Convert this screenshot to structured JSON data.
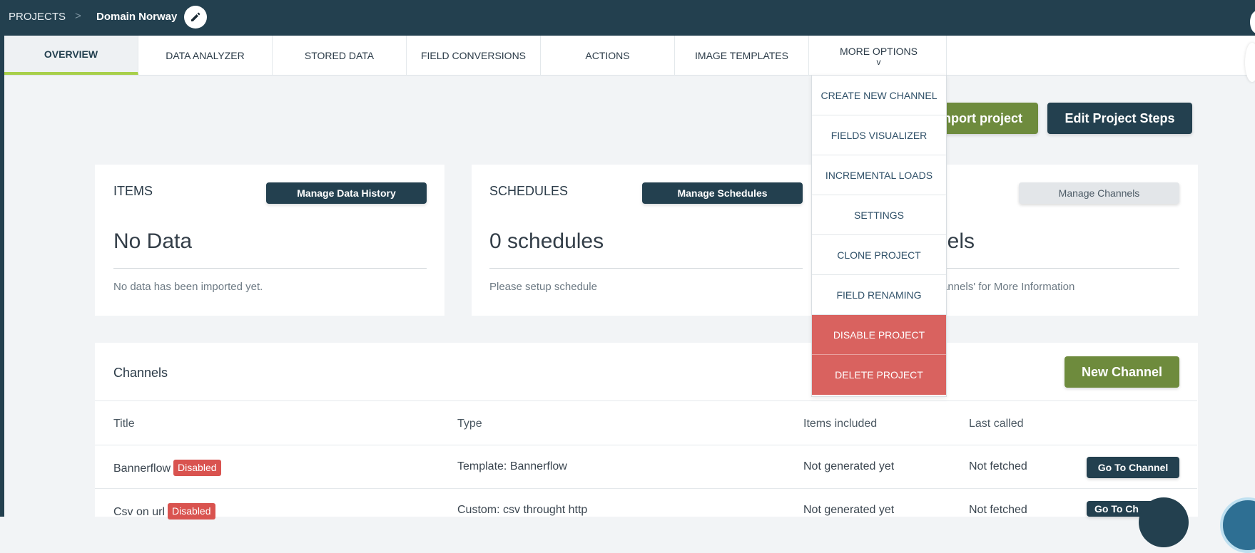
{
  "breadcrumb": {
    "root": "PROJECTS",
    "separator": ">",
    "current": "Domain Norway"
  },
  "tabs": [
    {
      "label": "OVERVIEW"
    },
    {
      "label": "DATA ANALYZER"
    },
    {
      "label": "STORED DATA"
    },
    {
      "label": "FIELD CONVERSIONS"
    },
    {
      "label": "ACTIONS"
    },
    {
      "label": "IMAGE TEMPLATES"
    },
    {
      "label": "MORE OPTIONS",
      "chevron": "v"
    }
  ],
  "header_actions": {
    "import": "nport project",
    "edit_steps": "Edit Project Steps"
  },
  "cards": {
    "items": {
      "title": "ITEMS",
      "button": "Manage Data History",
      "value": "No Data",
      "note": "No data has been imported yet."
    },
    "schedules": {
      "title": "SCHEDULES",
      "button": "Manage Schedules",
      "value": "0 schedules",
      "note": "Please setup schedule"
    },
    "channels": {
      "button": "Manage Channels",
      "value": "nels",
      "note": "annels' for More Information"
    }
  },
  "channels_table": {
    "title": "Channels",
    "new_button": "New Channel",
    "columns": [
      "Title",
      "Type",
      "Items included",
      "Last called"
    ],
    "rows": [
      {
        "title": "Bannerflow",
        "badge": "Disabled",
        "type": "Template: Bannerflow",
        "items": "Not generated yet",
        "last": "Not fetched",
        "action": "Go To Channel"
      },
      {
        "title": "Csv on url",
        "badge": "Disabled",
        "type": "Custom: csv throught http",
        "items": "Not generated yet",
        "last": "Not fetched",
        "action": "Go To Ch"
      }
    ]
  },
  "more_menu": [
    {
      "label": "CREATE NEW CHANNEL"
    },
    {
      "label": "FIELDS VISUALIZER"
    },
    {
      "label": "INCREMENTAL LOADS"
    },
    {
      "label": "SETTINGS"
    },
    {
      "label": "CLONE PROJECT"
    },
    {
      "label": "FIELD RENAMING"
    },
    {
      "label": "DISABLE PROJECT"
    },
    {
      "label": "DELETE PROJECT"
    }
  ],
  "colors": {
    "navy": "#23404f",
    "green": "#6e8b3d",
    "danger": "#d9625f",
    "accent": "#a8cf4a"
  }
}
